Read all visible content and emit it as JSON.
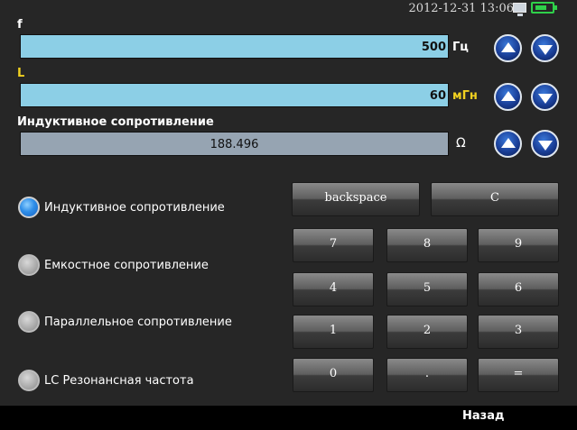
{
  "status": {
    "datetime": "2012-12-31  13:06",
    "monitor_icon": "monitor-icon",
    "battery_icon": "battery-icon"
  },
  "params": [
    {
      "label": "f",
      "label_color": "#ffffff",
      "value": "500",
      "unit": "Гц",
      "unit_color": "#ffffff"
    },
    {
      "label": "L",
      "label_color": "#f0d020",
      "value": "60",
      "unit": "мГн",
      "unit_color": "#f0d020"
    }
  ],
  "result": {
    "label": "Индуктивное сопротивление",
    "value": "188.496",
    "unit": "Ω"
  },
  "modes": [
    {
      "label": "Индуктивное сопротивление",
      "selected": true
    },
    {
      "label": "Емкостное сопротивление",
      "selected": false
    },
    {
      "label": "Параллельное сопротивление",
      "selected": false
    },
    {
      "label": "LC Резонансная частота",
      "selected": false
    }
  ],
  "keypad": {
    "backspace": "backspace",
    "clear": "C",
    "k7": "7",
    "k8": "8",
    "k9": "9",
    "k4": "4",
    "k5": "5",
    "k6": "6",
    "k1": "1",
    "k2": "2",
    "k3": "3",
    "k0": "0",
    "dot": ".",
    "equals": "="
  },
  "footer": {
    "back": "Назад"
  },
  "colors": {
    "input_field": "#8ccfe6",
    "output_field": "#96a4b2",
    "accent_blue": "#1a3f98",
    "battery": "#2fd04a"
  }
}
